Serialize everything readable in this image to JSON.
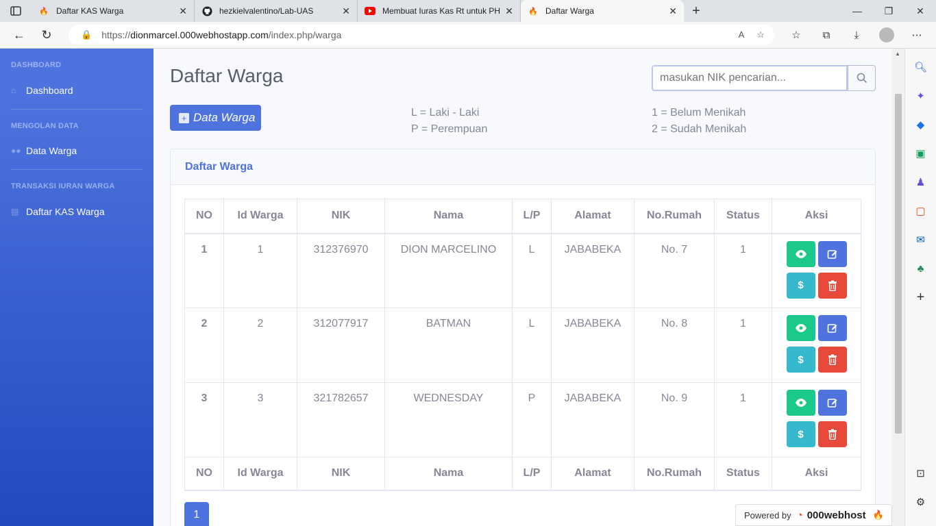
{
  "browser": {
    "tabs": [
      {
        "title": "Daftar KAS Warga",
        "icon": "fire-icon",
        "active": false
      },
      {
        "title": "hezkielvalentino/Lab-UAS",
        "icon": "github-icon",
        "active": false
      },
      {
        "title": "Membuat Iuras Kas Rt untuk PHP",
        "icon": "youtube-icon",
        "active": false
      },
      {
        "title": "Daftar Warga",
        "icon": "fire-icon",
        "active": true
      }
    ],
    "url_prefix": "https://",
    "url_host": "dionmarcel.000webhostapp.com",
    "url_path": "/index.php/warga"
  },
  "sidebar": {
    "sections": [
      {
        "heading": "DASHBOARD",
        "item": "Dashboard",
        "icon": "home-icon"
      },
      {
        "heading": "MENGOLAN DATA",
        "item": "Data Warga",
        "icon": "users-icon"
      },
      {
        "heading": "TRANSAKSI IURAN WARGA",
        "item": "Daftar KAS Warga",
        "icon": "list-icon"
      }
    ]
  },
  "main": {
    "title": "Daftar Warga",
    "search_placeholder": "masukan NIK pencarian...",
    "add_button": "Data Warga",
    "legend_gender": [
      "L = Laki - Laki",
      "P = Perempuan"
    ],
    "legend_status": [
      "1 = Belum Menikah",
      "2 = Sudah Menikah"
    ],
    "card_title": "Daftar Warga",
    "columns": [
      "NO",
      "Id Warga",
      "NIK",
      "Nama",
      "L/P",
      "Alamat",
      "No.Rumah",
      "Status",
      "Aksi"
    ],
    "rows": [
      {
        "no": "1",
        "id": "1",
        "nik": "312376970",
        "nama": "DION MARCELINO",
        "lp": "L",
        "alamat": "JABABEKA",
        "rumah": "No. 7",
        "status": "1"
      },
      {
        "no": "2",
        "id": "2",
        "nik": "312077917",
        "nama": "BATMAN",
        "lp": "L",
        "alamat": "JABABEKA",
        "rumah": "No. 8",
        "status": "1"
      },
      {
        "no": "3",
        "id": "3",
        "nik": "321782657",
        "nama": "WEDNESDAY",
        "lp": "P",
        "alamat": "JABABEKA",
        "rumah": "No. 9",
        "status": "1"
      }
    ],
    "page": "1",
    "pay_glyph": "$"
  },
  "footer": {
    "powered_by": "Powered by",
    "brand": "000webhost"
  },
  "colors": {
    "primary": "#4e73df",
    "success": "#1cc88a",
    "info": "#36b9cc",
    "danger": "#e74a3b"
  }
}
